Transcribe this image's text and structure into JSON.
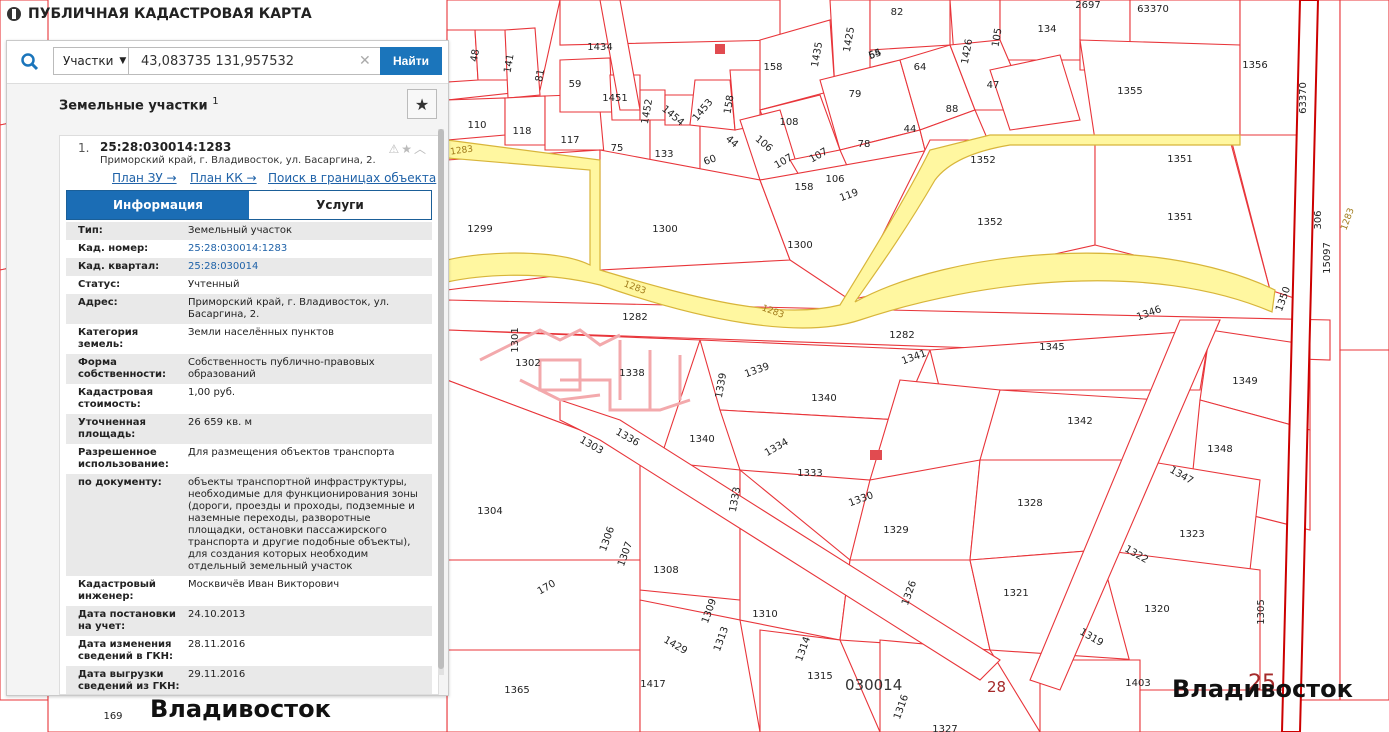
{
  "app": {
    "title": "ПУБЛИЧНАЯ КАДАСТРОВАЯ КАРТА"
  },
  "search": {
    "type_label": "Участки",
    "query": "43,083735 131,957532",
    "find_label": "Найти"
  },
  "list": {
    "title": "Земельные участки",
    "count": "1",
    "favorite_icon": "star-icon"
  },
  "card": {
    "index": "1.",
    "cadnum": "25:28:030014:1283",
    "address": "Приморский край, г. Владивосток, ул. Басаргина, 2.",
    "links": [
      "План ЗУ →",
      "План КК →",
      "Поиск в границах объекта →"
    ],
    "tabs": [
      "Информация",
      "Услуги"
    ],
    "rows": [
      {
        "k": "Тип:",
        "v": "Земельный участок"
      },
      {
        "k": "Кад. номер:",
        "v": "25:28:030014:1283",
        "link": true
      },
      {
        "k": "Кад. квартал:",
        "v": "25:28:030014",
        "link": true
      },
      {
        "k": "Статус:",
        "v": "Учтенный"
      },
      {
        "k": "Адрес:",
        "v": "Приморский край, г. Владивосток, ул. Басаргина, 2."
      },
      {
        "k": "Категория земель:",
        "v": "Земли населённых пунктов"
      },
      {
        "k": "Форма собственности:",
        "v": "Собственность публично-правовых образований"
      },
      {
        "k": "Кадастровая стоимость:",
        "v": "1,00 руб."
      },
      {
        "k": "Уточненная площадь:",
        "v": "26 659 кв. м"
      },
      {
        "k": "Разрешенное использование:",
        "v": "Для размещения объектов транспорта"
      },
      {
        "k": "по документу:",
        "v": "объекты транспортной инфраструктуры, необходимые для функционирования зоны (дороги, проезды и проходы, подземные и наземные переходы, разворотные площадки, остановки пассажирского транспорта и другие подобные объекты), для создания которых необходим отдельный земельный участок"
      },
      {
        "k": "Кадастровый инженер:",
        "v": "Москвичёв Иван Викторович"
      },
      {
        "k": "Дата постановки на учет:",
        "v": "24.10.2013"
      },
      {
        "k": "Дата изменения сведений в ГКН:",
        "v": "28.11.2016"
      },
      {
        "k": "Дата выгрузки сведений из ГКН:",
        "v": "29.11.2016"
      }
    ]
  },
  "map": {
    "city_labels": [
      "Владивосток",
      "Владивосток"
    ],
    "quarter_label": "030014",
    "district_label": "28",
    "district_label_2": "25",
    "parcels": [
      "1283",
      "1299",
      "1300",
      "1300",
      "1352",
      "1352",
      "1351",
      "1351",
      "1356",
      "1355",
      "1282",
      "1282",
      "1345",
      "1346",
      "1349",
      "1350",
      "1301",
      "1302",
      "1338",
      "1339",
      "1339",
      "1341",
      "1340",
      "1340",
      "1342",
      "1336",
      "1334",
      "1333",
      "1333",
      "1330",
      "1329",
      "1328",
      "1348",
      "1347",
      "1323",
      "1322",
      "1304",
      "1303",
      "1306",
      "1307",
      "1308",
      "1309",
      "1310",
      "1313",
      "1314",
      "1315",
      "1316",
      "1327",
      "1326",
      "1321",
      "1320",
      "1319",
      "1403",
      "1305",
      "1417",
      "1365",
      "169",
      "170",
      "1429",
      "1434",
      "1435",
      "1425",
      "1426",
      "105",
      "134",
      "158",
      "54",
      "64",
      "79",
      "88",
      "47",
      "108",
      "78",
      "44",
      "44",
      "106",
      "107",
      "107",
      "106",
      "158",
      "119",
      "110",
      "118",
      "117",
      "75",
      "133",
      "60",
      "48",
      "141",
      "81",
      "59",
      "1451",
      "1452",
      "1454",
      "1453",
      "158",
      "65",
      "82",
      "2697",
      "63370",
      "63370",
      "306",
      "15097",
      "1283",
      "1283",
      "1283"
    ]
  }
}
